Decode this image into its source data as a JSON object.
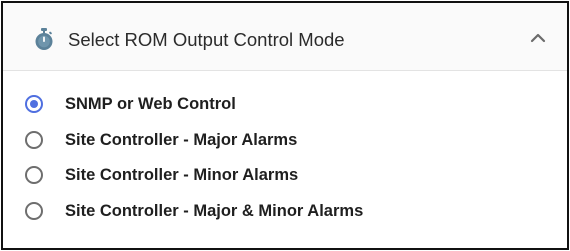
{
  "panel": {
    "title": "Select ROM Output Control Mode",
    "header_icon": "stopwatch-icon",
    "collapse_icon": "chevron-up-icon",
    "accent_color": "#4f6fe0",
    "options": [
      {
        "label": "SNMP or Web Control",
        "selected": true
      },
      {
        "label": "Site Controller - Major Alarms",
        "selected": false
      },
      {
        "label": "Site Controller - Minor Alarms",
        "selected": false
      },
      {
        "label": "Site Controller - Major & Minor Alarms",
        "selected": false
      }
    ]
  }
}
